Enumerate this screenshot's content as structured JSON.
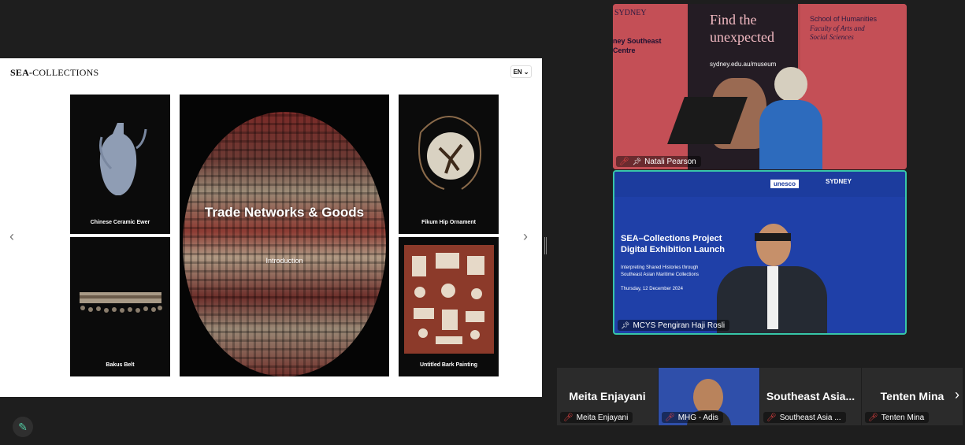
{
  "website": {
    "logo_bold": "SEA-",
    "logo_rest": "COLLECTIONS",
    "language": "EN",
    "tiles": [
      {
        "caption": "Chinese Ceramic Ewer"
      },
      {
        "caption": "Bakus Belt"
      },
      {
        "caption": "Fikum Hip Ornament"
      },
      {
        "caption": "Untitled Bark Painting"
      }
    ],
    "featured": {
      "title": "Trade Networks & Goods",
      "subtitle": "Introduction"
    }
  },
  "video": {
    "speaker1": {
      "name": "Natali Pearson",
      "banner_left": [
        "SYDNEY",
        "ney Southeast",
        "Centre"
      ],
      "banner_middle": [
        "Find the",
        "unexpected",
        "sydney.edu.au/museum"
      ],
      "banner_right": [
        "School of Humanities",
        "Faculty of Arts and",
        "Social Sciences"
      ]
    },
    "speaker2": {
      "name": "MCYS Pengiran Haji Rosli",
      "slide_title": "SEA–Collections Project Digital Exhibition Launch",
      "slide_sub": "Interpreting Shared Histories through Southeast Asian Maritime Collections",
      "slide_date": "Thursday, 12 December 2024",
      "logo_unesco": "unesco",
      "logo_sydney": "SYDNEY"
    },
    "participants": [
      {
        "big_name": "Meita Enjayani",
        "label": "Meita Enjayani"
      },
      {
        "big_name": "",
        "label": "MHG - Adis"
      },
      {
        "big_name": "Southeast  Asia...",
        "label": "Southeast Asia ..."
      },
      {
        "big_name": "Tenten Mina",
        "label": "Tenten Mina"
      }
    ]
  },
  "colors": {
    "accent": "#37c6a8",
    "mic_off": "#e44444"
  }
}
